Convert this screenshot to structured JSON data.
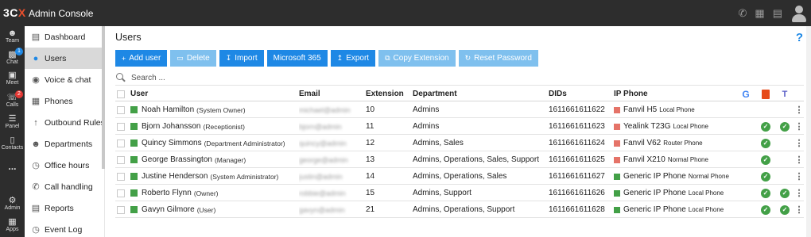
{
  "topbar": {
    "logo_main": "3C",
    "logo_x": "X",
    "title": "Admin Console",
    "icons": [
      "phone-icon",
      "dialpad-icon",
      "book-icon",
      "user-avatar-icon"
    ]
  },
  "rail": {
    "items": [
      {
        "label": "Team",
        "icon": "team-icon"
      },
      {
        "label": "Chat",
        "icon": "chat-icon",
        "badge": "1"
      },
      {
        "label": "Meet",
        "icon": "meet-icon"
      },
      {
        "label": "Calls",
        "icon": "calls-icon",
        "badge": "2"
      },
      {
        "label": "Panel",
        "icon": "panel-icon"
      },
      {
        "label": "Contacts",
        "icon": "contacts-icon"
      },
      {
        "label": "...",
        "icon": "more-icon"
      },
      {
        "label": "Admin",
        "icon": "gear-icon"
      },
      {
        "label": "Apps",
        "icon": "apps-icon"
      }
    ]
  },
  "nav": {
    "items": [
      {
        "label": "Dashboard",
        "icon": "dashboard-icon"
      },
      {
        "label": "Users",
        "icon": "user-icon",
        "active": true
      },
      {
        "label": "Voice & chat",
        "icon": "globe-icon"
      },
      {
        "label": "Phones",
        "icon": "phone-device-icon"
      },
      {
        "label": "Outbound Rules",
        "icon": "arrow-up-icon"
      },
      {
        "label": "Departments",
        "icon": "departments-icon"
      },
      {
        "label": "Office hours",
        "icon": "clock-icon"
      },
      {
        "label": "Call handling",
        "icon": "call-handling-icon"
      },
      {
        "label": "Reports",
        "icon": "reports-icon"
      },
      {
        "label": "Event Log",
        "icon": "event-log-icon"
      }
    ]
  },
  "main": {
    "title": "Users",
    "help": "?",
    "toolbar": {
      "add_user": "Add user",
      "delete": "Delete",
      "import": "Import",
      "microsoft365": "Microsoft 365",
      "export": "Export",
      "copy_extension": "Copy Extension",
      "reset_password": "Reset Password"
    },
    "search_placeholder": "Search ...",
    "columns": {
      "user": "User",
      "email": "Email",
      "extension": "Extension",
      "department": "Department",
      "dids": "DIDs",
      "ip_phone": "IP Phone"
    },
    "rows": [
      {
        "name": "Noah Hamilton",
        "role": "(System Owner)",
        "email": "michael@admin",
        "ext": "10",
        "dept": "Admins",
        "did": "1611661611622",
        "phone": "Fanvil H5",
        "phone_type": "Local Phone",
        "phone_color": "#e57368",
        "ms365": false,
        "teams": false
      },
      {
        "name": "Bjorn Johansson",
        "role": "(Receptionist)",
        "email": "bjorn@admin",
        "ext": "11",
        "dept": "Admins",
        "did": "1611661611623",
        "phone": "Yealink T23G",
        "phone_type": "Local Phone",
        "phone_color": "#e57368",
        "ms365": true,
        "teams": true
      },
      {
        "name": "Quincy Simmons",
        "role": "(Department Administrator)",
        "email": "quincy@admin",
        "ext": "12",
        "dept": "Admins, Sales",
        "did": "1611661611624",
        "phone": "Fanvil V62",
        "phone_type": "Router Phone",
        "phone_color": "#e57368",
        "ms365": true,
        "teams": false
      },
      {
        "name": "George Brassington",
        "role": "(Manager)",
        "email": "george@admin",
        "ext": "13",
        "dept": "Admins, Operations, Sales, Support",
        "did": "1611661611625",
        "phone": "Fanvil X210",
        "phone_type": "Normal Phone",
        "phone_color": "#e57368",
        "ms365": true,
        "teams": false
      },
      {
        "name": "Justine Henderson",
        "role": "(System Administrator)",
        "email": "justin@admin",
        "ext": "14",
        "dept": "Admins, Operations, Sales",
        "did": "1611661611627",
        "phone": "Generic IP Phone",
        "phone_type": "Normal Phone",
        "phone_color": "#43a047",
        "ms365": true,
        "teams": false
      },
      {
        "name": "Roberto Flynn",
        "role": "(Owner)",
        "email": "robbie@admin",
        "ext": "15",
        "dept": "Admins, Support",
        "did": "1611661611626",
        "phone": "Generic IP Phone",
        "phone_type": "Local Phone",
        "phone_color": "#43a047",
        "ms365": true,
        "teams": true
      },
      {
        "name": "Gavyn Gilmore",
        "role": "(User)",
        "email": "gavyn@admin",
        "ext": "21",
        "dept": "Admins, Operations, Support",
        "did": "1611661611628",
        "phone": "Generic IP Phone",
        "phone_type": "Local Phone",
        "phone_color": "#43a047",
        "ms365": true,
        "teams": true
      }
    ]
  },
  "colors": {
    "accent": "#1e88e5",
    "accent_disabled": "#7fc0ee",
    "topbar": "#2d2d2d",
    "online": "#43a047",
    "phone_error": "#e57368"
  }
}
